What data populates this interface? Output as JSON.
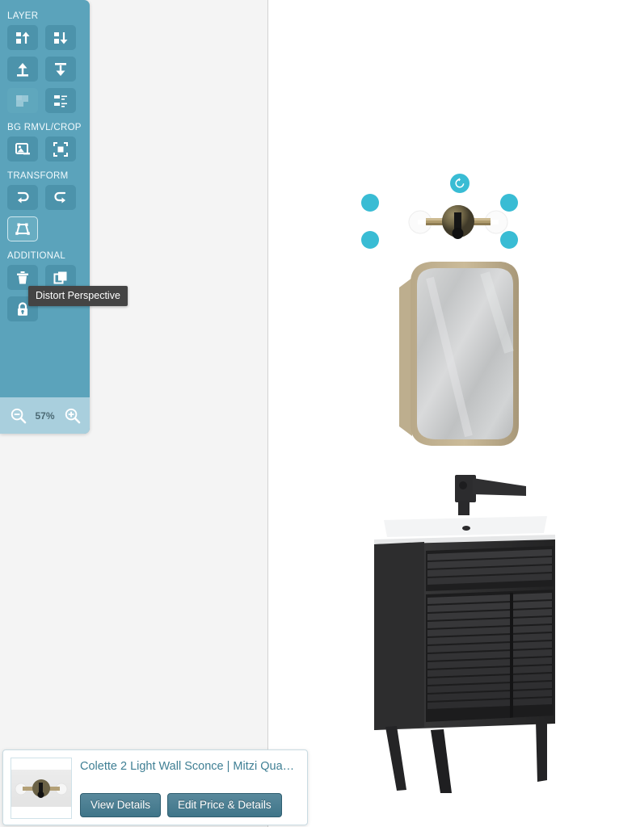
{
  "toolbar": {
    "sections": [
      {
        "label": "LAYER",
        "buttons": [
          {
            "name": "bring-forward-button",
            "icon": "layer-up-icon",
            "state": "enabled"
          },
          {
            "name": "send-backward-button",
            "icon": "layer-down-icon",
            "state": "enabled"
          },
          {
            "name": "bring-to-front-button",
            "icon": "move-to-top-icon",
            "state": "enabled"
          },
          {
            "name": "send-to-back-button",
            "icon": "move-to-bottom-icon",
            "state": "enabled"
          },
          {
            "name": "merge-layers-button",
            "icon": "merge-shapes-icon",
            "state": "disabled"
          },
          {
            "name": "align-distribute-button",
            "icon": "align-icon",
            "state": "enabled"
          }
        ]
      },
      {
        "label": "BG RMVL/CROP",
        "buttons": [
          {
            "name": "remove-background-button",
            "icon": "image-remove-icon",
            "state": "enabled"
          },
          {
            "name": "crop-button",
            "icon": "crop-frame-icon",
            "state": "enabled"
          }
        ]
      },
      {
        "label": "TRANSFORM",
        "buttons": [
          {
            "name": "flip-horizontal-button",
            "icon": "flip-horizontal-icon",
            "state": "enabled"
          },
          {
            "name": "flip-vertical-button",
            "icon": "flip-vertical-icon",
            "state": "enabled"
          },
          {
            "name": "distort-perspective-button",
            "icon": "perspective-icon",
            "state": "active"
          }
        ]
      },
      {
        "label": "ADDITIONAL",
        "buttons": [
          {
            "name": "delete-button",
            "icon": "trash-icon",
            "state": "enabled"
          },
          {
            "name": "duplicate-button",
            "icon": "copy-icon",
            "state": "enabled"
          },
          {
            "name": "lock-button",
            "icon": "lock-icon",
            "state": "enabled"
          }
        ]
      }
    ],
    "zoom": {
      "level": "57%",
      "zoom_out_name": "zoom-out-button",
      "zoom_in_name": "zoom-in-button"
    }
  },
  "tooltip": {
    "text": "Distort Perspective"
  },
  "canvas": {
    "selection": {
      "rotate_handle": "rotate-handle",
      "handles": [
        "handle-top-left",
        "handle-top-right",
        "handle-bottom-left",
        "handle-bottom-right"
      ]
    },
    "objects": [
      {
        "name": "wall-sconce-object",
        "label": "Colette 2 Light Wall Sconce"
      },
      {
        "name": "mirror-object",
        "label": "Brass framed oval mirror"
      },
      {
        "name": "vanity-object",
        "label": "Black louvered vanity with sink and faucet"
      }
    ]
  },
  "product_card": {
    "title": "Colette 2 Light Wall Sconce | Mitzi Qua…",
    "thumbnail_alt": "Colette 2 Light Wall Sconce thumbnail",
    "view_details_label": "View Details",
    "edit_price_label": "Edit Price & Details"
  },
  "colors": {
    "toolbar_bg": "#5ba3bb",
    "button_bg": "#4c93ab",
    "zoom_bar_bg": "#a9cfdd",
    "handle": "#39bcd4",
    "accent_text": "#3f7f94",
    "card_button": "#4a7f93",
    "tooltip_bg": "#444444"
  }
}
